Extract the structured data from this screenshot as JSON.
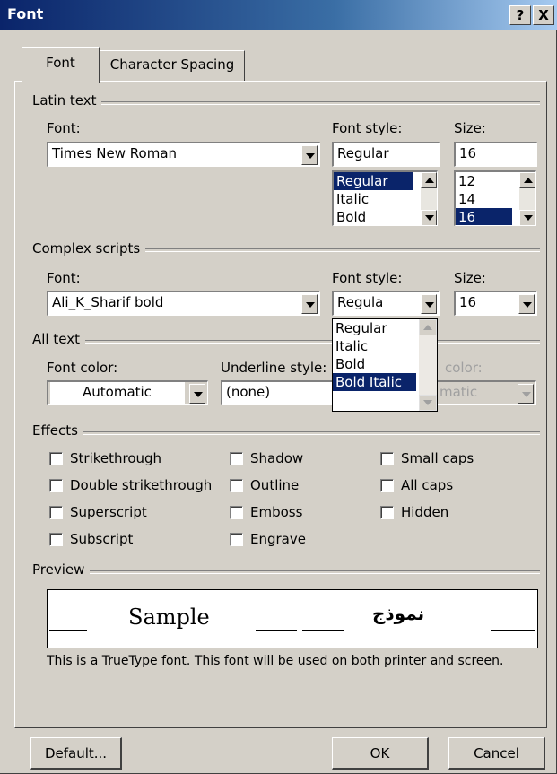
{
  "window": {
    "title": "Font",
    "help_button": "?",
    "close_button": "X"
  },
  "tabs": [
    {
      "label": "Font",
      "active": true
    },
    {
      "label": "Character Spacing",
      "active": false
    }
  ],
  "latin": {
    "group_label": "Latin text",
    "font_label": "Font:",
    "font_value": "Times New Roman",
    "style_label": "Font style:",
    "style_value": "Regular",
    "style_options": [
      "Regular",
      "Italic",
      "Bold"
    ],
    "size_label": "Size:",
    "size_value": "16",
    "size_options": [
      "12",
      "14",
      "16"
    ]
  },
  "complex": {
    "group_label": "Complex scripts",
    "font_label": "Font:",
    "font_value": "Ali_K_Sharif bold",
    "style_label": "Font style:",
    "style_value": "Regula",
    "style_dropdown_options": [
      "Regular",
      "Italic",
      "Bold",
      "Bold Italic"
    ],
    "size_label": "Size:",
    "size_value": "16"
  },
  "all_text": {
    "group_label": "All text",
    "color_label": "Font color:",
    "color_value": "Automatic",
    "underline_label": "Underline style:",
    "underline_value": "(none)",
    "underline_color_label": "color:",
    "underline_color_value": "matic"
  },
  "effects": {
    "group_label": "Effects",
    "col1": [
      "Strikethrough",
      "Double strikethrough",
      "Superscript",
      "Subscript"
    ],
    "col2": [
      "Shadow",
      "Outline",
      "Emboss",
      "Engrave"
    ],
    "col3": [
      "Small caps",
      "All caps",
      "Hidden"
    ]
  },
  "preview": {
    "group_label": "Preview",
    "sample_latin": "Sample",
    "sample_complex": "نموذج",
    "note": "This is a TrueType font. This font will be used on both printer and screen."
  },
  "buttons": {
    "default": "Default...",
    "ok": "OK",
    "cancel": "Cancel"
  },
  "colors": {
    "face": "#d4d0c8",
    "selection": "#0a246a",
    "title_start": "#0a246a"
  }
}
